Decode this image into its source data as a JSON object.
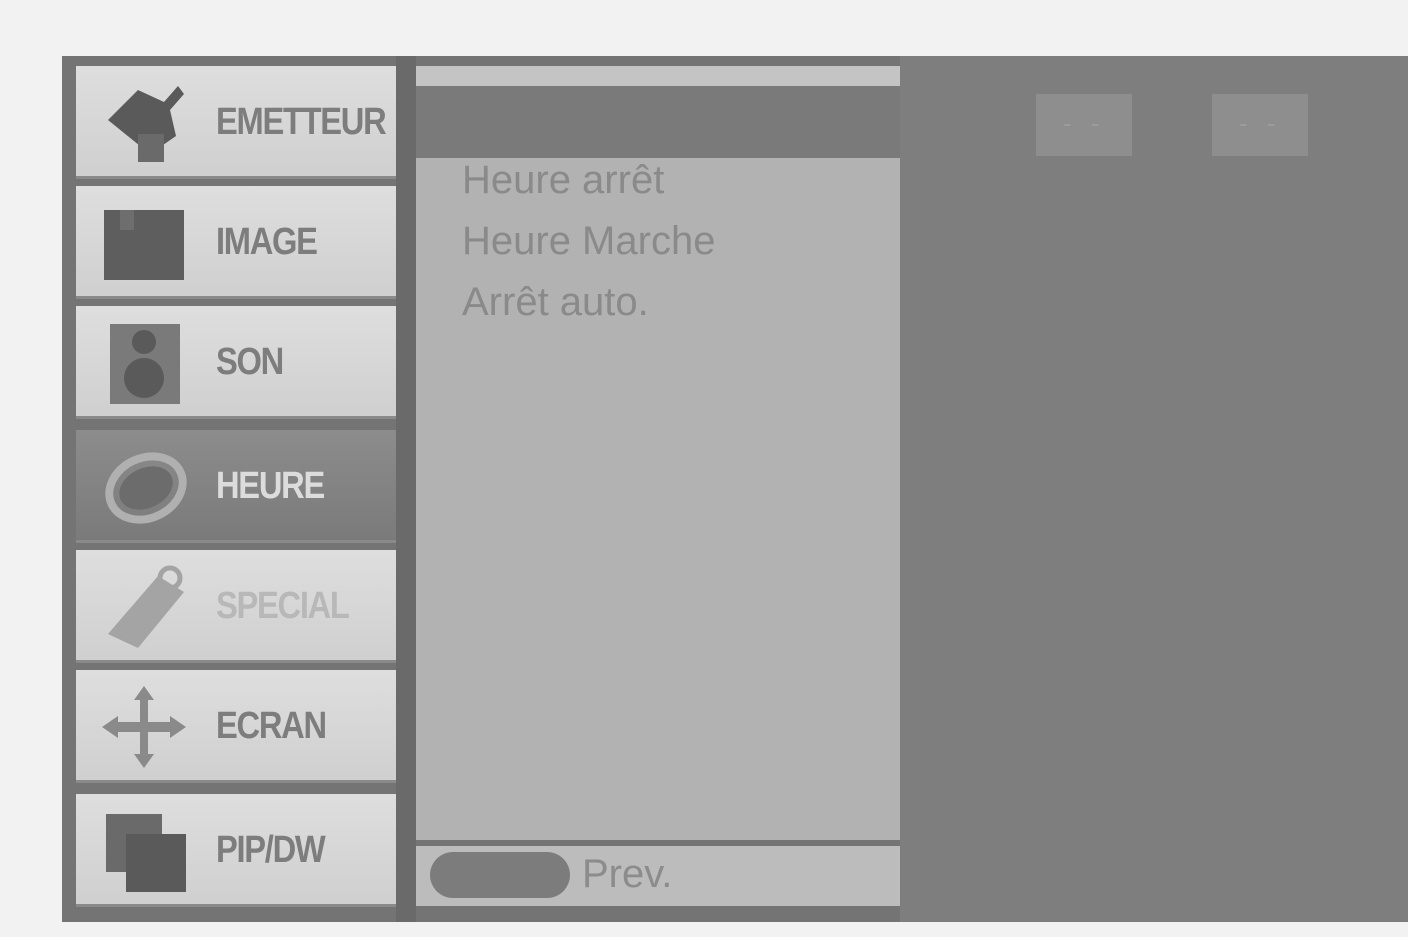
{
  "menu": {
    "items": [
      {
        "label": "EMETTEUR",
        "icon": "satellite-dish-icon",
        "state": "normal"
      },
      {
        "label": "IMAGE",
        "icon": "picture-icon",
        "state": "normal"
      },
      {
        "label": "SON",
        "icon": "speaker-icon",
        "state": "normal"
      },
      {
        "label": "HEURE",
        "icon": "clock-ring-icon",
        "state": "active"
      },
      {
        "label": "SPECIAL",
        "icon": "tag-icon",
        "state": "dim"
      },
      {
        "label": "ECRAN",
        "icon": "move-arrows-icon",
        "state": "normal"
      },
      {
        "label": "PIP/DW",
        "icon": "pip-windows-icon",
        "state": "normal"
      }
    ]
  },
  "submenu": {
    "items": [
      "Heure arrêt",
      "Heure Marche",
      "Arrêt auto."
    ]
  },
  "footer": {
    "prev_label": "Prev."
  },
  "time_display": {
    "hours": "- -",
    "minutes": "- -"
  },
  "colors": {
    "active_menu": "#828282",
    "menu_bg": "#d6d6d6",
    "panel_bg": "#b2b2b2",
    "right_bg": "#7e7e7e"
  }
}
